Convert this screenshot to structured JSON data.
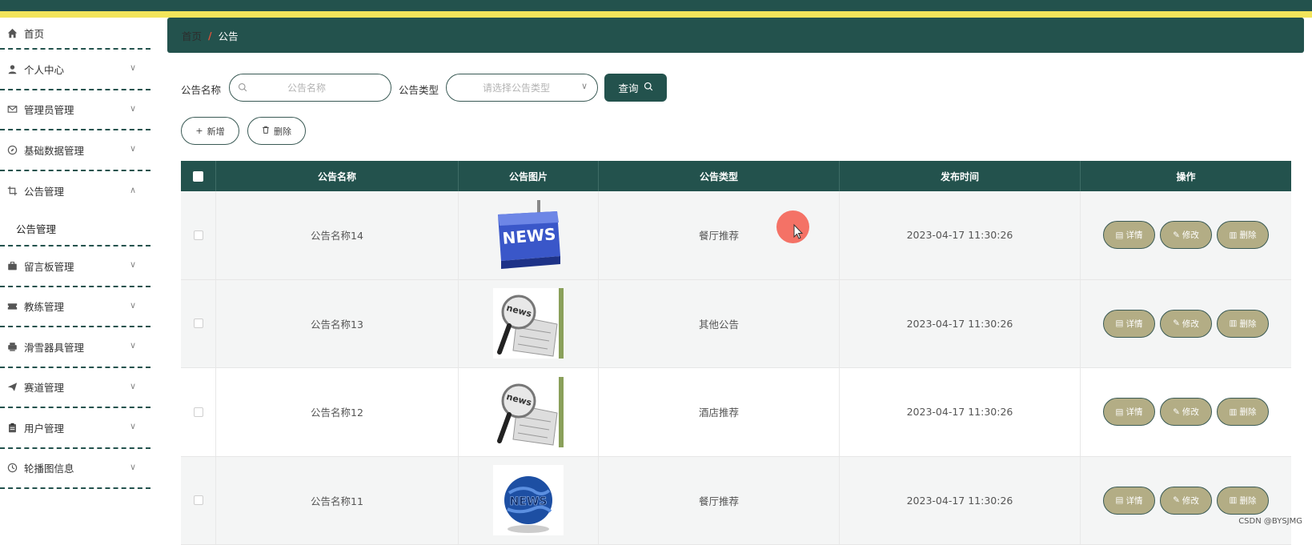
{
  "colors": {
    "primary": "#23524d",
    "stripe": "#f2e45a",
    "op_button": "#b3ad85",
    "breadcrumb_sep": "#e0523a"
  },
  "sidebar": {
    "items": [
      {
        "label": "首页",
        "icon": "home-icon"
      },
      {
        "label": "个人中心",
        "icon": "user-icon"
      },
      {
        "label": "管理员管理",
        "icon": "mail-icon"
      },
      {
        "label": "基础数据管理",
        "icon": "compass-icon"
      },
      {
        "label": "公告管理",
        "icon": "crop-icon",
        "sub": "公告管理"
      },
      {
        "label": "留言板管理",
        "icon": "briefcase-icon"
      },
      {
        "label": "教练管理",
        "icon": "ticket-icon"
      },
      {
        "label": "滑雪器具管理",
        "icon": "printer-icon"
      },
      {
        "label": "赛道管理",
        "icon": "send-icon"
      },
      {
        "label": "用户管理",
        "icon": "clipboard-icon"
      },
      {
        "label": "轮播图信息",
        "icon": "clock-icon"
      }
    ]
  },
  "breadcrumb": {
    "home": "首页",
    "sep": "/",
    "current": "公告"
  },
  "search": {
    "name_label": "公告名称",
    "name_placeholder": "公告名称",
    "type_label": "公告类型",
    "type_placeholder": "请选择公告类型",
    "query_label": "查询"
  },
  "actions": {
    "add_label": "新增",
    "delete_label": "删除"
  },
  "table": {
    "headers": [
      "公告名称",
      "公告图片",
      "公告类型",
      "发布时间",
      "操作"
    ],
    "rows": [
      {
        "name": "公告名称14",
        "image": "news-keyboard",
        "type": "餐厅推荐",
        "time": "2023-04-17 11:30:26"
      },
      {
        "name": "公告名称13",
        "image": "news-magnifier",
        "type": "其他公告",
        "time": "2023-04-17 11:30:26"
      },
      {
        "name": "公告名称12",
        "image": "news-magnifier",
        "type": "酒店推荐",
        "time": "2023-04-17 11:30:26"
      },
      {
        "name": "公告名称11",
        "image": "news-globe",
        "type": "餐厅推荐",
        "time": "2023-04-17 11:30:26"
      }
    ],
    "op_labels": {
      "detail": "详情",
      "edit": "修改",
      "delete": "删除"
    }
  },
  "watermark": "CSDN @BYSJMG"
}
